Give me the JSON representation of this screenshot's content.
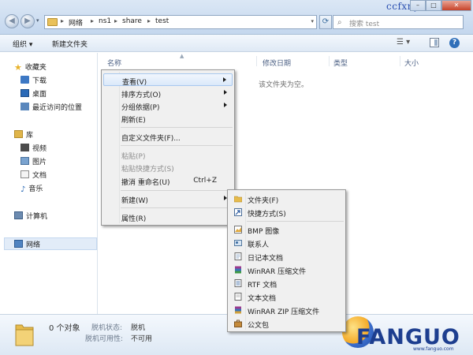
{
  "titlebar": {
    "watermark": "ccfxny.b",
    "breadcrumbs": [
      "网络",
      "ns1",
      "share",
      "test"
    ],
    "search_placeholder": "搜索 test"
  },
  "toolbar": {
    "organize_label": "组织 ▾",
    "new_folder_label": "新建文件夹"
  },
  "nav_pane": {
    "favorites": {
      "label": "收藏夹",
      "items": [
        "下载",
        "桌面",
        "最近访问的位置"
      ]
    },
    "libraries": {
      "label": "库",
      "items": [
        "视频",
        "图片",
        "文档",
        "音乐"
      ]
    },
    "computer": "计算机",
    "network": "网络"
  },
  "content": {
    "columns": [
      "名称",
      "修改日期",
      "类型",
      "大小"
    ],
    "empty_message": "该文件夹为空。"
  },
  "context_menu": {
    "items": [
      {
        "label": "查看(V)",
        "submenu": true,
        "highlight": true
      },
      {
        "label": "排序方式(O)",
        "submenu": true
      },
      {
        "label": "分组依据(P)",
        "submenu": true
      },
      {
        "label": "刷新(E)"
      },
      {
        "label": "自定义文件夹(F)..."
      },
      {
        "label": "粘贴(P)",
        "disabled": true
      },
      {
        "label": "粘贴快捷方式(S)",
        "disabled": true
      },
      {
        "label": "撤消 重命名(U)",
        "shortcut": "Ctrl+Z"
      },
      {
        "label": "新建(W)",
        "submenu": true
      },
      {
        "label": "属性(R)"
      }
    ]
  },
  "submenu": {
    "items": [
      {
        "label": "文件夹(F)",
        "icon": "folder-icon"
      },
      {
        "label": "快捷方式(S)",
        "icon": "shortcut-icon"
      },
      {
        "label": "BMP 图像",
        "icon": "bmp-image-icon"
      },
      {
        "label": "联系人",
        "icon": "contact-icon"
      },
      {
        "label": "日记本文档",
        "icon": "journal-icon"
      },
      {
        "label": "WinRAR 压缩文件",
        "icon": "winrar-icon"
      },
      {
        "label": "RTF 文档",
        "icon": "rtf-document-icon"
      },
      {
        "label": "文本文档",
        "icon": "text-document-icon"
      },
      {
        "label": "WinRAR ZIP 压缩文件",
        "icon": "winrar-zip-icon"
      },
      {
        "label": "公文包",
        "icon": "briefcase-icon"
      }
    ]
  },
  "details": {
    "count": "0 个对象",
    "status_label": "脱机状态:",
    "status_value": "脱机",
    "availability_label": "脱机可用性:",
    "availability_value": "不可用"
  },
  "watermark": {
    "brand": "FANGUO",
    "url": "www.fanguo.com"
  },
  "colors": {
    "accent": "#2f6fb9",
    "menu_highlight": "#dbe9fa",
    "folder": "#e9c15a"
  }
}
